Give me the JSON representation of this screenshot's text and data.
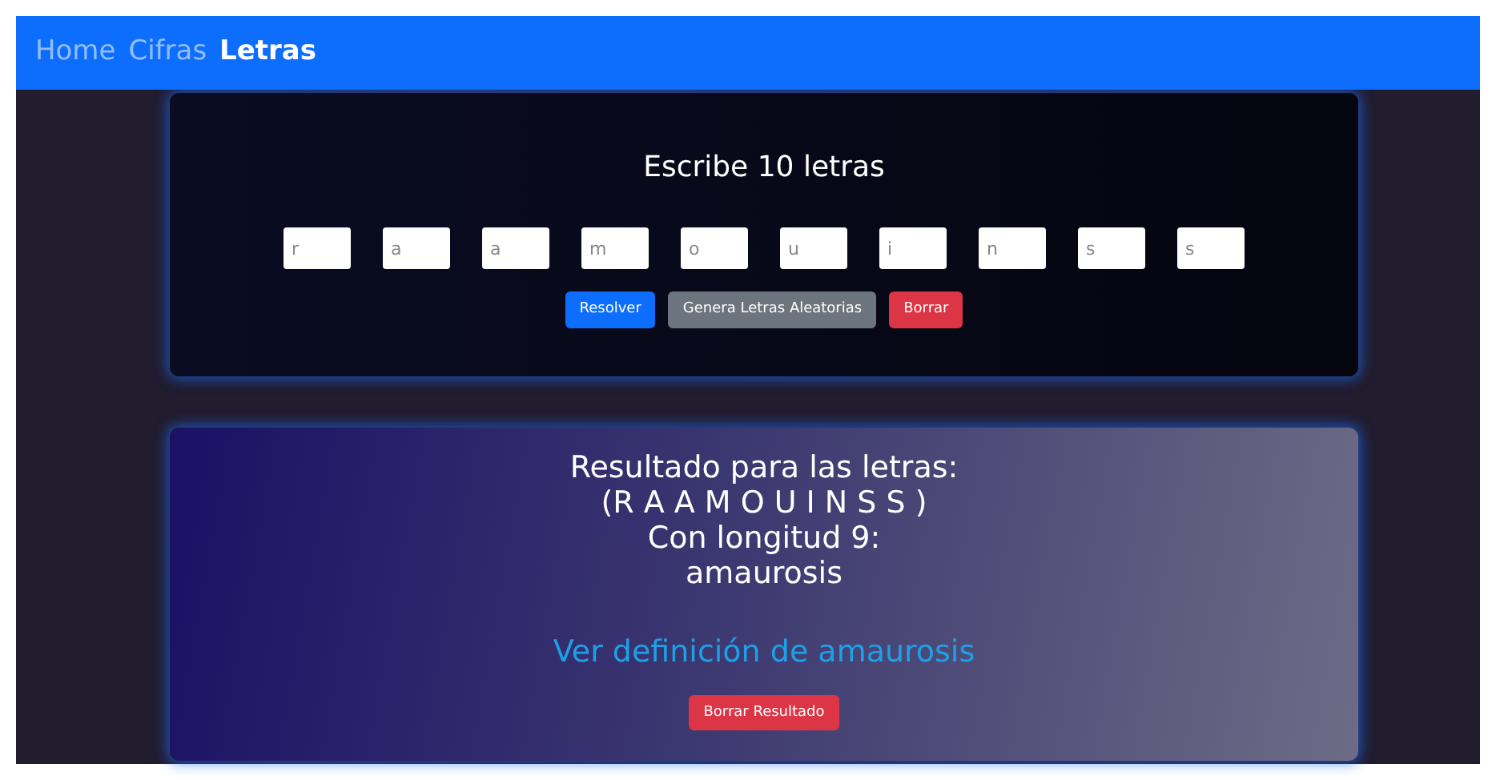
{
  "nav": [
    {
      "label": "Home",
      "selected": false
    },
    {
      "label": "Cifras",
      "selected": false
    },
    {
      "label": "Letras",
      "selected": true
    }
  ],
  "form": {
    "title": "Escribe 10 letras",
    "letters": [
      "r",
      "a",
      "a",
      "m",
      "o",
      "u",
      "i",
      "n",
      "s",
      "s"
    ],
    "buttons": [
      {
        "label": "Resolver",
        "kind": "primary"
      },
      {
        "label": "Genera Letras Aleatorias",
        "kind": "secondary"
      },
      {
        "label": "Borrar",
        "kind": "danger"
      }
    ]
  },
  "result": {
    "lines": [
      "Resultado para las letras:",
      "(R A A M O U I N S S )",
      "Con longitud 9:",
      "amaurosis"
    ],
    "link": "Ver definición de amaurosis",
    "button": {
      "label": "Borrar Resultado",
      "kind": "danger"
    }
  }
}
